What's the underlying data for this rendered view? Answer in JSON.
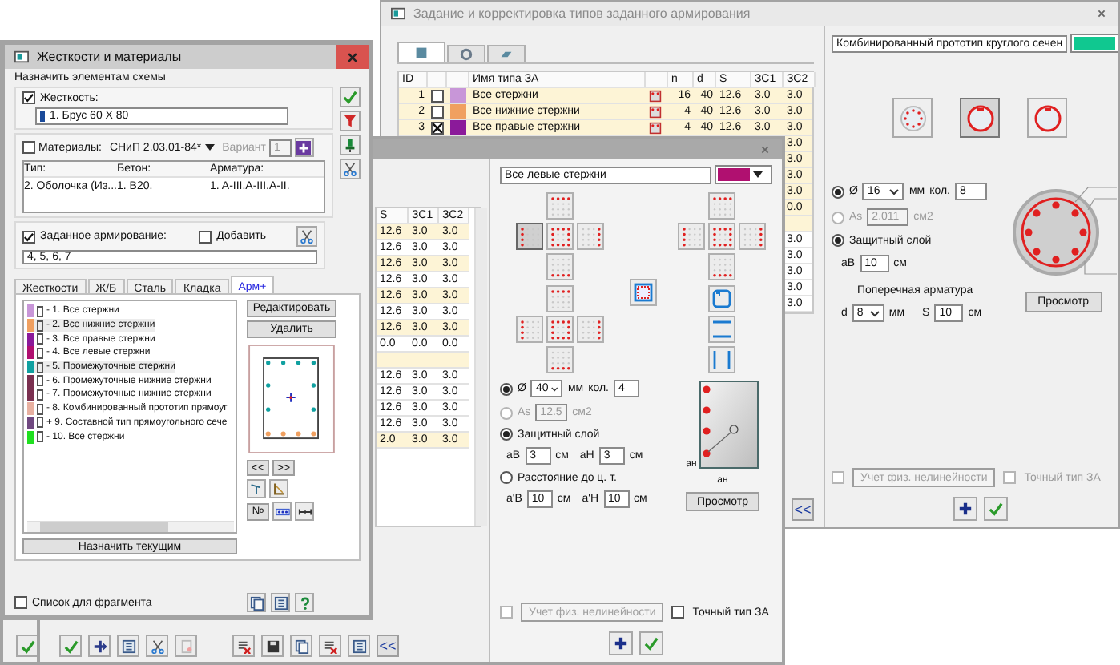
{
  "back_window": {
    "title": "Задание и корректировка типов заданного армирования",
    "tabs": [
      {
        "selected": true
      },
      {
        "selected": false
      },
      {
        "selected": false
      }
    ],
    "table": {
      "columns": [
        "ID",
        "Имя типа ЗА",
        "n",
        "d",
        "S",
        "ЗС1",
        "ЗС2"
      ],
      "rows": [
        {
          "id": "1",
          "checked": false,
          "color": "#c896d8",
          "name": "Все стержни",
          "n": "16",
          "d": "40",
          "s": "12.6",
          "zs1": "3.0",
          "zs2": "3.0"
        },
        {
          "id": "2",
          "checked": false,
          "color": "#f0a060",
          "name": "Все нижние стержни",
          "n": "4",
          "d": "40",
          "s": "12.6",
          "zs1": "3.0",
          "zs2": "3.0"
        },
        {
          "id": "3",
          "checked": true,
          "color": "#8b1a9a",
          "name": "Все правые стержни",
          "n": "4",
          "d": "40",
          "s": "12.6",
          "zs1": "3.0",
          "zs2": "3.0"
        }
      ],
      "zs2_more": [
        "3.0",
        "3.0",
        "3.0",
        "3.0",
        "0.0"
      ],
      "zs2_after_gap": [
        "3.0",
        "3.0",
        "3.0",
        "3.0",
        "3.0"
      ]
    },
    "editor": {
      "name": "Комбинированный прототип круглого сечен",
      "color": "#10c890",
      "shapes": [
        {
          "selected": false
        },
        {
          "selected": true
        },
        {
          "selected": false
        }
      ],
      "diameter": {
        "selected": true,
        "label": "Ø",
        "value": "16",
        "unit": "мм"
      },
      "count_label": "кол.",
      "count": "8",
      "area": {
        "selected": false,
        "disabled": true,
        "label": "As",
        "value": "2.011",
        "unit": "см2"
      },
      "cover": {
        "selected": true,
        "label": "Защитный слой",
        "ab_label": "aB",
        "ab": "10",
        "unit": "см"
      },
      "transverse": {
        "title": "Поперечная арматура",
        "d_label": "d",
        "d": "8",
        "d_unit": "мм",
        "s_label": "S",
        "s": "10",
        "s_unit": "см"
      },
      "preview": "Просмотр",
      "nonlinear": {
        "checked": false,
        "disabled": true,
        "label": "Учет физ. нелинейности"
      },
      "exact": {
        "checked": false,
        "disabled": true,
        "label": "Точный тип ЗА"
      }
    },
    "back_button": "<<"
  },
  "middle_window": {
    "table": {
      "columns": [
        "S",
        "ЗС1",
        "ЗС2"
      ],
      "rows": [
        {
          "cells": [
            "12.6",
            "3.0",
            "3.0"
          ],
          "highlighted": true
        },
        {
          "cells": [
            "12.6",
            "3.0",
            "3.0"
          ],
          "highlighted": false
        },
        {
          "cells": [
            "12.6",
            "3.0",
            "3.0"
          ],
          "highlighted": true
        },
        {
          "cells": [
            "12.6",
            "3.0",
            "3.0"
          ],
          "highlighted": false
        },
        {
          "cells": [
            "12.6",
            "3.0",
            "3.0"
          ],
          "highlighted": true
        },
        {
          "cells": [
            "12.6",
            "3.0",
            "3.0"
          ],
          "highlighted": false
        },
        {
          "cells": [
            "12.6",
            "3.0",
            "3.0"
          ],
          "highlighted": true
        },
        {
          "cells": [
            "0.0",
            "0.0",
            "0.0"
          ],
          "highlighted": false
        },
        {
          "cells": [
            "",
            "",
            ""
          ],
          "highlighted": true
        },
        {
          "cells": [
            "12.6",
            "3.0",
            "3.0"
          ],
          "highlighted": false
        },
        {
          "cells": [
            "12.6",
            "3.0",
            "3.0"
          ],
          "highlighted": false
        },
        {
          "cells": [
            "12.6",
            "3.0",
            "3.0"
          ],
          "highlighted": false
        },
        {
          "cells": [
            "12.6",
            "3.0",
            "3.0"
          ],
          "highlighted": false
        },
        {
          "cells": [
            "2.0",
            "3.0",
            "3.0"
          ],
          "highlighted": true
        }
      ]
    },
    "back_button": "<<",
    "editor": {
      "name": "Все левые стержни",
      "color": "#b01070",
      "crosses": [
        [
          {
            "selected": false
          },
          {
            "selected": true
          },
          {
            "selected": false
          },
          {
            "selected": false
          },
          {
            "selected": false
          }
        ],
        [
          {
            "selected": false
          },
          {
            "selected": false
          },
          {
            "selected": false
          },
          {
            "selected": false
          },
          {
            "selected": false
          }
        ],
        [
          {
            "selected": false
          },
          {
            "selected": false
          },
          {
            "selected": false
          },
          {
            "selected": false
          },
          {
            "selected": false
          }
        ]
      ],
      "diameter": {
        "selected": true,
        "label": "Ø",
        "value": "40",
        "unit": "мм"
      },
      "count_label": "кол.",
      "count": "4",
      "area": {
        "selected": false,
        "disabled": true,
        "label": "As",
        "value": "12.5",
        "unit": "см2"
      },
      "cover": {
        "selected": true,
        "label": "Защитный слой",
        "ab_label": "aB",
        "ab": "3",
        "ab_unit": "см",
        "ah_label": "aH",
        "ah": "3",
        "ah_unit": "см"
      },
      "distance": {
        "selected": false,
        "label": "Расстояние до ц. т.",
        "ab_label": "a'B",
        "ab": "10",
        "ab_unit": "см",
        "ah_label": "a'H",
        "ah": "10",
        "ah_unit": "см"
      },
      "section_labels": [
        "aн",
        "aн"
      ],
      "preview": "Просмотр",
      "nonlinear": {
        "checked": false,
        "disabled": true,
        "label": "Учет физ. нелинейности"
      },
      "exact": {
        "checked": false,
        "disabled": false,
        "label": "Точный тип ЗА"
      }
    }
  },
  "left_window": {
    "title": "Жесткости и материалы",
    "assign_label": "Назначить элементам схемы",
    "stiffness": {
      "checked": true,
      "label": "Жесткость:",
      "value": "1. Брус 60 X 80"
    },
    "materials": {
      "checked": false,
      "label": "Материалы:",
      "norm": "СНиП 2.03.01-84*",
      "variant_label": "Вариант",
      "variant": "1",
      "columns": [
        "Тип:",
        "Бетон:",
        "Арматура:"
      ],
      "row": [
        "2. Оболочка (Из...",
        "1. B20.",
        "1. A-III.A-III.A-II."
      ]
    },
    "given": {
      "checked": true,
      "label": "Заданное армирование:",
      "add": {
        "checked": false,
        "label": "Добавить"
      },
      "value": "4, 5, 6, 7"
    },
    "tabs": [
      {
        "label": "Жесткости",
        "selected": false
      },
      {
        "label": "Ж/Б",
        "selected": false
      },
      {
        "label": "Сталь",
        "selected": false
      },
      {
        "label": "Кладка",
        "selected": false
      },
      {
        "label": "Арм+",
        "selected": true
      }
    ],
    "types": [
      {
        "label": "- 1. Все стержни",
        "color": "#c896d8",
        "selected": false
      },
      {
        "label": "- 2. Все нижние стержни",
        "color": "#f0a060",
        "selected": true
      },
      {
        "label": "- 3. Все правые стержни",
        "color": "#8b1a9a",
        "selected": false
      },
      {
        "label": "- 4. Все левые стержни",
        "color": "#b01070",
        "selected": false
      },
      {
        "label": "- 5. Промежуточные стержни",
        "color": "#10a0a0",
        "selected": true
      },
      {
        "label": "- 6. Промежуточные нижние стержни",
        "color": "#7a3050",
        "selected": false
      },
      {
        "label": "- 7. Промежуточные нижние стержни",
        "color": "#7a3050",
        "selected": false
      },
      {
        "label": "- 8. Комбинированный прототип прямоуг",
        "color": "#e8b0a0",
        "selected": false
      },
      {
        "label": "+ 9. Составной тип прямоугольного сече",
        "color": "#704880",
        "selected": false
      },
      {
        "label": "- 10. Все стержни",
        "color": "#20e020",
        "selected": false
      }
    ],
    "edit": "Редактировать",
    "delete": "Удалить",
    "nav": [
      "<<",
      ">>"
    ],
    "number": "№",
    "assign_current": "Назначить текущим",
    "fragment": {
      "checked": false,
      "label": "Список для фрагмента"
    }
  }
}
